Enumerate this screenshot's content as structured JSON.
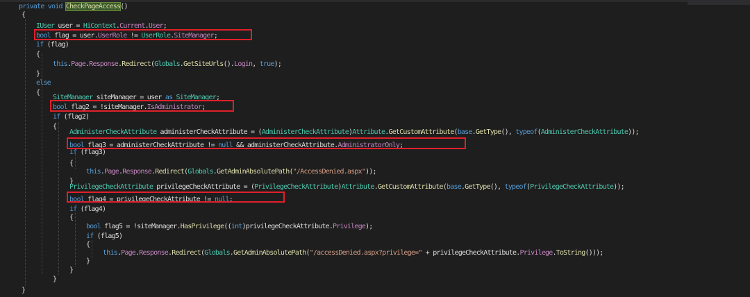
{
  "colors": {
    "background": "#1e1e1e",
    "keyword": "#569cd6",
    "type": "#4ec9b0",
    "method": "#dcdcaa",
    "property": "#c586c0",
    "string": "#d69d85",
    "plain": "#dcdcdc",
    "highlight_box": "#e0202a"
  },
  "code": {
    "lines": [
      [
        {
          "t": "kw",
          "v": "private"
        },
        {
          "t": "pl",
          "v": " "
        },
        {
          "t": "kw",
          "v": "void"
        },
        {
          "t": "pl",
          "v": " "
        },
        {
          "t": "hl",
          "v": "CheckPageAccess"
        },
        {
          "t": "pl",
          "v": "()"
        }
      ],
      [
        {
          "t": "pl",
          "v": "{"
        }
      ],
      [
        {
          "t": "type",
          "v": "IUser"
        },
        {
          "t": "pl",
          "v": " user = "
        },
        {
          "t": "type",
          "v": "HiContext"
        },
        {
          "t": "pl",
          "v": "."
        },
        {
          "t": "prop",
          "v": "Current"
        },
        {
          "t": "pl",
          "v": "."
        },
        {
          "t": "prop",
          "v": "User"
        },
        {
          "t": "pl",
          "v": ";"
        }
      ],
      [
        {
          "t": "kw",
          "v": "bool"
        },
        {
          "t": "pl",
          "v": " flag = user."
        },
        {
          "t": "prop",
          "v": "UserRole"
        },
        {
          "t": "pl",
          "v": " != "
        },
        {
          "t": "type",
          "v": "UserRole"
        },
        {
          "t": "pl",
          "v": "."
        },
        {
          "t": "prop",
          "v": "SiteManager"
        },
        {
          "t": "pl",
          "v": ";"
        }
      ],
      [
        {
          "t": "kw",
          "v": "if"
        },
        {
          "t": "pl",
          "v": " (flag)"
        }
      ],
      [
        {
          "t": "pl",
          "v": "{"
        }
      ],
      [
        {
          "t": "kw",
          "v": "this"
        },
        {
          "t": "pl",
          "v": "."
        },
        {
          "t": "prop",
          "v": "Page"
        },
        {
          "t": "pl",
          "v": "."
        },
        {
          "t": "prop",
          "v": "Response"
        },
        {
          "t": "pl",
          "v": "."
        },
        {
          "t": "meth",
          "v": "Redirect"
        },
        {
          "t": "pl",
          "v": "("
        },
        {
          "t": "type",
          "v": "Globals"
        },
        {
          "t": "pl",
          "v": "."
        },
        {
          "t": "meth",
          "v": "GetSiteUrls"
        },
        {
          "t": "pl",
          "v": "()."
        },
        {
          "t": "prop",
          "v": "Login"
        },
        {
          "t": "pl",
          "v": ", "
        },
        {
          "t": "kw",
          "v": "true"
        },
        {
          "t": "pl",
          "v": ");"
        }
      ],
      [
        {
          "t": "pl",
          "v": "}"
        }
      ],
      [
        {
          "t": "kw",
          "v": "else"
        }
      ],
      [
        {
          "t": "pl",
          "v": "{"
        }
      ],
      [
        {
          "t": "type",
          "v": "SiteManager"
        },
        {
          "t": "pl",
          "v": " siteManager = user "
        },
        {
          "t": "kw",
          "v": "as"
        },
        {
          "t": "pl",
          "v": " "
        },
        {
          "t": "type",
          "v": "SiteManager"
        },
        {
          "t": "pl",
          "v": ";"
        }
      ],
      [
        {
          "t": "kw",
          "v": "bool"
        },
        {
          "t": "pl",
          "v": " flag2 = !siteManager."
        },
        {
          "t": "prop",
          "v": "IsAdministrator"
        },
        {
          "t": "pl",
          "v": ";"
        }
      ],
      [
        {
          "t": "kw",
          "v": "if"
        },
        {
          "t": "pl",
          "v": " (flag2)"
        }
      ],
      [
        {
          "t": "pl",
          "v": "{"
        }
      ],
      [
        {
          "t": "type",
          "v": "AdministerCheckAttribute"
        },
        {
          "t": "pl",
          "v": " administerCheckAttribute = ("
        },
        {
          "t": "type",
          "v": "AdministerCheckAttribute"
        },
        {
          "t": "pl",
          "v": ")"
        },
        {
          "t": "type",
          "v": "Attribute"
        },
        {
          "t": "pl",
          "v": "."
        },
        {
          "t": "meth",
          "v": "GetCustomAttribute"
        },
        {
          "t": "pl",
          "v": "("
        },
        {
          "t": "kw",
          "v": "base"
        },
        {
          "t": "pl",
          "v": "."
        },
        {
          "t": "meth",
          "v": "GetType"
        },
        {
          "t": "pl",
          "v": "(), "
        },
        {
          "t": "kw",
          "v": "typeof"
        },
        {
          "t": "pl",
          "v": "("
        },
        {
          "t": "type",
          "v": "AdministerCheckAttribute"
        },
        {
          "t": "pl",
          "v": "));"
        }
      ],
      [
        {
          "t": "kw",
          "v": "bool"
        },
        {
          "t": "pl",
          "v": " flag3 = administerCheckAttribute != "
        },
        {
          "t": "kw",
          "v": "null"
        },
        {
          "t": "pl",
          "v": " && administerCheckAttribute."
        },
        {
          "t": "prop",
          "v": "AdministratorOnly"
        },
        {
          "t": "pl",
          "v": ";"
        }
      ],
      [
        {
          "t": "kw",
          "v": "if"
        },
        {
          "t": "pl",
          "v": " (flag3)"
        }
      ],
      [
        {
          "t": "pl",
          "v": "{"
        }
      ],
      [
        {
          "t": "kw",
          "v": "this"
        },
        {
          "t": "pl",
          "v": "."
        },
        {
          "t": "prop",
          "v": "Page"
        },
        {
          "t": "pl",
          "v": "."
        },
        {
          "t": "prop",
          "v": "Response"
        },
        {
          "t": "pl",
          "v": "."
        },
        {
          "t": "meth",
          "v": "Redirect"
        },
        {
          "t": "pl",
          "v": "("
        },
        {
          "t": "type",
          "v": "Globals"
        },
        {
          "t": "pl",
          "v": "."
        },
        {
          "t": "meth",
          "v": "GetAdminAbsolutePath"
        },
        {
          "t": "pl",
          "v": "("
        },
        {
          "t": "str",
          "v": "\"/AccessDenied.aspx\""
        },
        {
          "t": "pl",
          "v": "));"
        }
      ],
      [
        {
          "t": "pl",
          "v": "}"
        }
      ],
      [
        {
          "t": "type",
          "v": "PrivilegeCheckAttribute"
        },
        {
          "t": "pl",
          "v": " privilegeCheckAttribute = ("
        },
        {
          "t": "type",
          "v": "PrivilegeCheckAttribute"
        },
        {
          "t": "pl",
          "v": ")"
        },
        {
          "t": "type",
          "v": "Attribute"
        },
        {
          "t": "pl",
          "v": "."
        },
        {
          "t": "meth",
          "v": "GetCustomAttribute"
        },
        {
          "t": "pl",
          "v": "("
        },
        {
          "t": "kw",
          "v": "base"
        },
        {
          "t": "pl",
          "v": "."
        },
        {
          "t": "meth",
          "v": "GetType"
        },
        {
          "t": "pl",
          "v": "(), "
        },
        {
          "t": "kw",
          "v": "typeof"
        },
        {
          "t": "pl",
          "v": "("
        },
        {
          "t": "type",
          "v": "PrivilegeCheckAttribute"
        },
        {
          "t": "pl",
          "v": "));"
        }
      ],
      [
        {
          "t": "kw",
          "v": "bool"
        },
        {
          "t": "pl",
          "v": " flag4 = privilegeCheckAttribute != "
        },
        {
          "t": "kw",
          "v": "null"
        },
        {
          "t": "pl",
          "v": ";"
        }
      ],
      [
        {
          "t": "kw",
          "v": "if"
        },
        {
          "t": "pl",
          "v": " (flag4)"
        }
      ],
      [
        {
          "t": "pl",
          "v": "{"
        }
      ],
      [
        {
          "t": "kw",
          "v": "bool"
        },
        {
          "t": "pl",
          "v": " flag5 = !siteManager."
        },
        {
          "t": "meth",
          "v": "HasPrivilege"
        },
        {
          "t": "pl",
          "v": "(("
        },
        {
          "t": "kw",
          "v": "int"
        },
        {
          "t": "pl",
          "v": ")privilegeCheckAttribute."
        },
        {
          "t": "prop",
          "v": "Privilege"
        },
        {
          "t": "pl",
          "v": ");"
        }
      ],
      [
        {
          "t": "kw",
          "v": "if"
        },
        {
          "t": "pl",
          "v": " (flag5)"
        }
      ],
      [
        {
          "t": "pl",
          "v": "{"
        }
      ],
      [
        {
          "t": "kw",
          "v": "this"
        },
        {
          "t": "pl",
          "v": "."
        },
        {
          "t": "prop",
          "v": "Page"
        },
        {
          "t": "pl",
          "v": "."
        },
        {
          "t": "prop",
          "v": "Response"
        },
        {
          "t": "pl",
          "v": "."
        },
        {
          "t": "meth",
          "v": "Redirect"
        },
        {
          "t": "pl",
          "v": "("
        },
        {
          "t": "type",
          "v": "Globals"
        },
        {
          "t": "pl",
          "v": "."
        },
        {
          "t": "meth",
          "v": "GetAdminAbsolutePath"
        },
        {
          "t": "pl",
          "v": "("
        },
        {
          "t": "str",
          "v": "\"/accessDenied.aspx?privilege=\""
        },
        {
          "t": "pl",
          "v": " + privilegeCheckAttribute."
        },
        {
          "t": "prop",
          "v": "Privilege"
        },
        {
          "t": "pl",
          "v": "."
        },
        {
          "t": "meth",
          "v": "ToString"
        },
        {
          "t": "pl",
          "v": "()));"
        }
      ],
      [
        {
          "t": "pl",
          "v": "}"
        }
      ],
      [
        {
          "t": "pl",
          "v": "}"
        }
      ],
      [
        {
          "t": "pl",
          "v": "}"
        }
      ],
      [
        {
          "t": "pl",
          "v": "}"
        }
      ]
    ]
  }
}
